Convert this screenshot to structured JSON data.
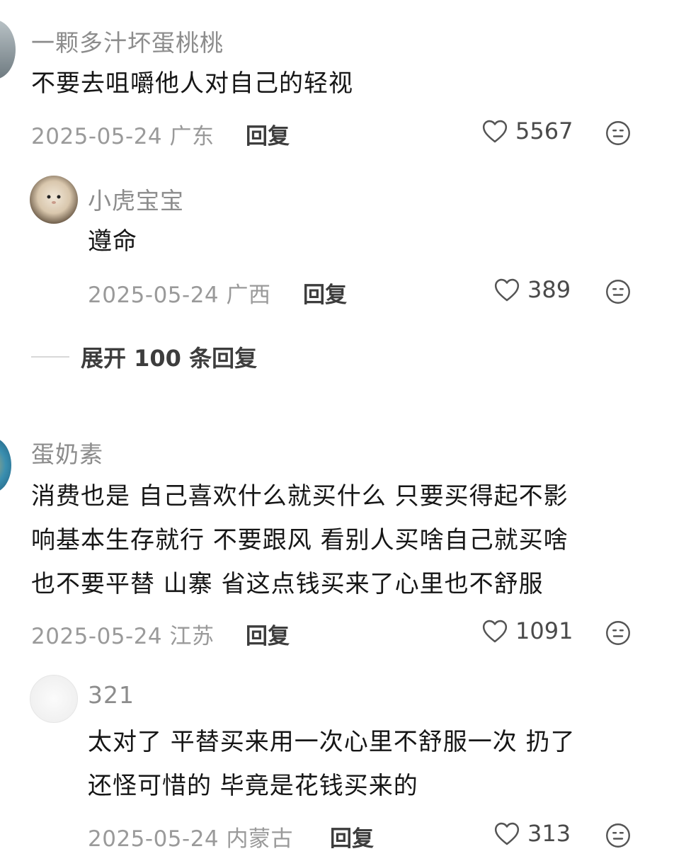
{
  "comments": [
    {
      "user": "一颗多汁坏蛋桃桃",
      "text_lines": [
        "不要去咀嚼他人对自己的轻视"
      ],
      "date_loc": "2025-05-24 广东",
      "reply_label": "回复",
      "likes": "5567",
      "replies": [
        {
          "user": "小虎宝宝",
          "text_lines": [
            "遵命"
          ],
          "date_loc": "2025-05-24 广西",
          "reply_label": "回复",
          "likes": "389"
        }
      ],
      "expand_label": "展开 100 条回复"
    },
    {
      "user": "蛋奶素",
      "text_lines": [
        "消费也是 自己喜欢什么就买什么 只要买得起不影",
        "响基本生存就行 不要跟风 看别人买啥自己就买啥",
        "也不要平替 山寨 省这点钱买来了心里也不舒服"
      ],
      "date_loc": "2025-05-24 江苏",
      "reply_label": "回复",
      "likes": "1091",
      "replies": [
        {
          "user": "321",
          "text_lines": [
            "太对了 平替买来用一次心里不舒服一次 扔了",
            "还怪可惜的 毕竟是花钱买来的"
          ],
          "date_loc": "2025-05-24 内蒙古",
          "reply_label": "回复",
          "likes": "313"
        }
      ]
    }
  ],
  "icons": {
    "like": "heart-outline-icon",
    "more": "neutral-face-icon"
  },
  "colors": {
    "text": "#161616",
    "username": "#8c8c8c",
    "meta": "#9a9a9a",
    "background": "#ffffff"
  }
}
